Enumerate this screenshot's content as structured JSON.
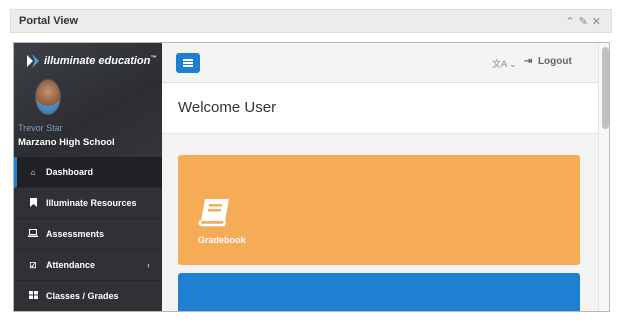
{
  "portal": {
    "title": "Portal View",
    "actions": {
      "collapse_icon": "chevron-up-icon",
      "edit_icon": "pencil-icon",
      "close_icon": "close-icon"
    }
  },
  "sidebar": {
    "logo_text": "illuminate education",
    "logo_mark": "™",
    "user_name": "Trevor Star",
    "school": "Marzano High School",
    "items": [
      {
        "label": "Dashboard",
        "icon": "home-icon",
        "active": true
      },
      {
        "label": "Illuminate Resources",
        "icon": "bookmark-icon"
      },
      {
        "label": "Assessments",
        "icon": "laptop-icon"
      },
      {
        "label": "Attendance",
        "icon": "checkbox-icon",
        "caret": "‹"
      },
      {
        "label": "Classes / Grades",
        "icon": "grid-icon"
      }
    ]
  },
  "topbar": {
    "language_label": "文A ⌄",
    "logout_label": "Logout"
  },
  "welcome": {
    "text": "Welcome User"
  },
  "cards": [
    {
      "label": "Gradebook",
      "color": "#f6ab57",
      "icon": "book-icon"
    },
    {
      "label": "",
      "color": "#1f7fd0"
    }
  ],
  "colors": {
    "accent": "#1f7fd0",
    "sidebar_bg": "#2f3135",
    "gradebook": "#f6ab57"
  }
}
